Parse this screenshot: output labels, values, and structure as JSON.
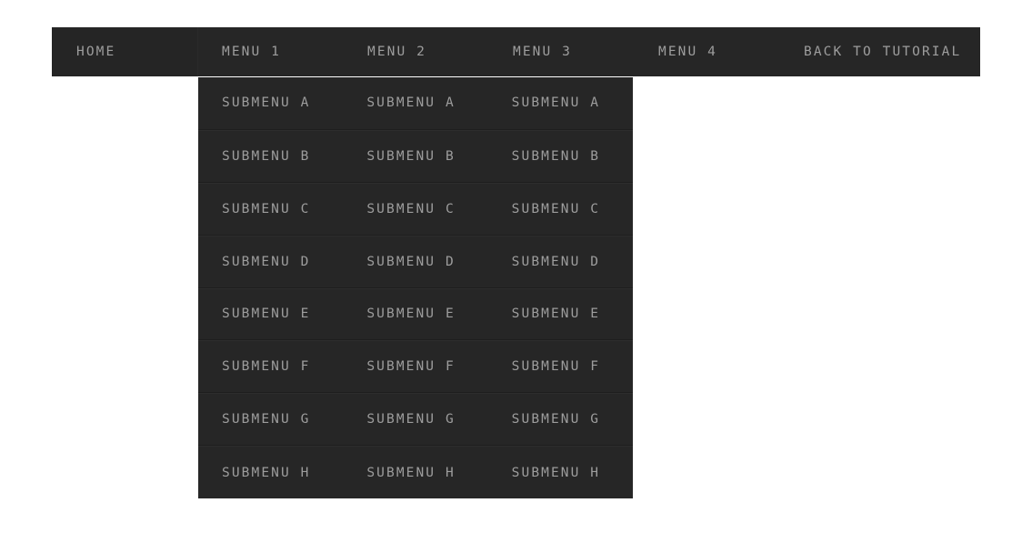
{
  "navbar": {
    "items": [
      {
        "label": "HOME",
        "name": "nav-item-home"
      },
      {
        "label": "MENU 1",
        "name": "nav-item-menu-1"
      },
      {
        "label": "MENU 2",
        "name": "nav-item-menu-2"
      },
      {
        "label": "MENU 3",
        "name": "nav-item-menu-3"
      },
      {
        "label": "MENU 4",
        "name": "nav-item-menu-4"
      },
      {
        "label": "BACK TO TUTORIAL",
        "name": "nav-item-back-to-tutorial"
      }
    ]
  },
  "submenu": {
    "open_under": "MENU 1",
    "columns": [
      {
        "parent": "MENU 1",
        "items": [
          "SUBMENU A",
          "SUBMENU B",
          "SUBMENU C",
          "SUBMENU D",
          "SUBMENU E",
          "SUBMENU F",
          "SUBMENU G",
          "SUBMENU H"
        ]
      },
      {
        "parent": "MENU 2",
        "items": [
          "SUBMENU A",
          "SUBMENU B",
          "SUBMENU C",
          "SUBMENU D",
          "SUBMENU E",
          "SUBMENU F",
          "SUBMENU G",
          "SUBMENU H"
        ]
      },
      {
        "parent": "MENU 3",
        "items": [
          "SUBMENU A",
          "SUBMENU B",
          "SUBMENU C",
          "SUBMENU D",
          "SUBMENU E",
          "SUBMENU F",
          "SUBMENU G",
          "SUBMENU H"
        ]
      }
    ]
  },
  "colors": {
    "page_background": "#ffffff",
    "bar_background": "#262626",
    "home_cell_background": "#252525",
    "text": "#9d9d9d",
    "row_separator_dark": "#1e1e1e",
    "row_separator_light": "#2d2d2d"
  }
}
